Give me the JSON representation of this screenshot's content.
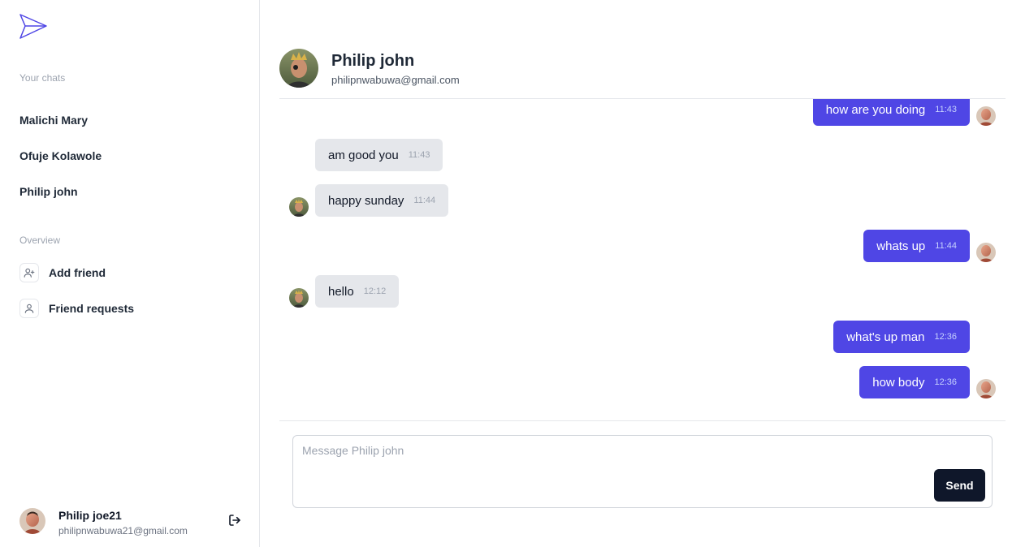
{
  "sidebar": {
    "logo_icon": "send-plane-icon",
    "chats_label": "Your chats",
    "chats": [
      {
        "name": "Malichi Mary"
      },
      {
        "name": "Ofuje Kolawole"
      },
      {
        "name": "Philip john"
      }
    ],
    "overview_label": "Overview",
    "overview": [
      {
        "label": "Add friend",
        "icon": "user-plus-icon"
      },
      {
        "label": "Friend requests",
        "icon": "user-icon"
      }
    ],
    "profile": {
      "name": "Philip joe21",
      "email": "philipnwabuwa21@gmail.com",
      "logout_icon": "logout-icon"
    }
  },
  "chat": {
    "partner": {
      "name": "Philip john",
      "email": "philipnwabuwa@gmail.com"
    },
    "messages": [
      {
        "text": "how are you doing",
        "time": "11:43",
        "direction": "out"
      },
      {
        "text": "am good you",
        "time": "11:43",
        "direction": "in"
      },
      {
        "text": "happy sunday",
        "time": "11:44",
        "direction": "in"
      },
      {
        "text": "whats up",
        "time": "11:44",
        "direction": "out"
      },
      {
        "text": "hello",
        "time": "12:12",
        "direction": "in"
      },
      {
        "text": "what's up man",
        "time": "12:36",
        "direction": "out"
      },
      {
        "text": "how body",
        "time": "12:36",
        "direction": "out"
      }
    ],
    "composer": {
      "placeholder": "Message Philip john",
      "value": "",
      "send_label": "Send"
    }
  },
  "colors": {
    "accent": "#4f46e5",
    "incoming_bubble": "#e5e7eb",
    "send_button": "#0f172a"
  }
}
